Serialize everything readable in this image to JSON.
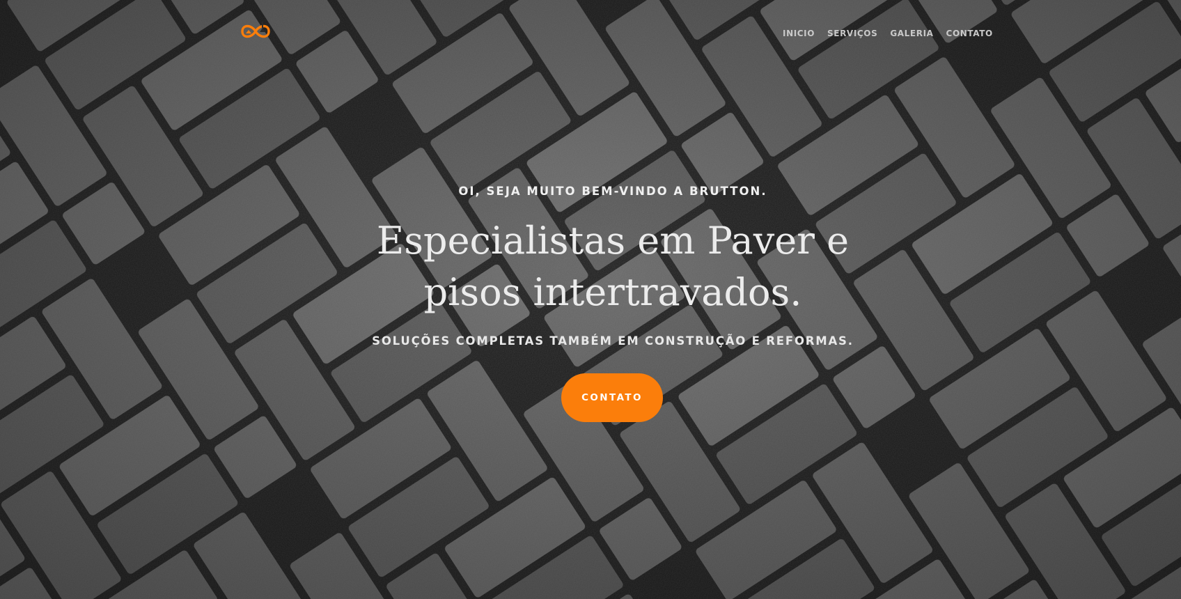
{
  "nav": {
    "items": [
      {
        "label": "INICIO"
      },
      {
        "label": "SERVIÇOS"
      },
      {
        "label": "GALERIA"
      },
      {
        "label": "CONTATO"
      }
    ]
  },
  "logo": {
    "icon": "infinity-house-logo",
    "color": "#fb7e0b"
  },
  "hero": {
    "kicker": "OI, SEJA MUITO BEM-VINDO A BRUTTON.",
    "title_line1": "Especialistas em Paver e",
    "title_line2": "pisos intertravados.",
    "subtitle": "SOLUÇÕES COMPLETAS TAMBÉM EM CONSTRUÇÃO E REFORMAS.",
    "cta_label": "CONTATO"
  },
  "colors": {
    "accent": "#fb7e0b",
    "paver": "#6a6a6a",
    "joint": "#1c1c1c"
  }
}
